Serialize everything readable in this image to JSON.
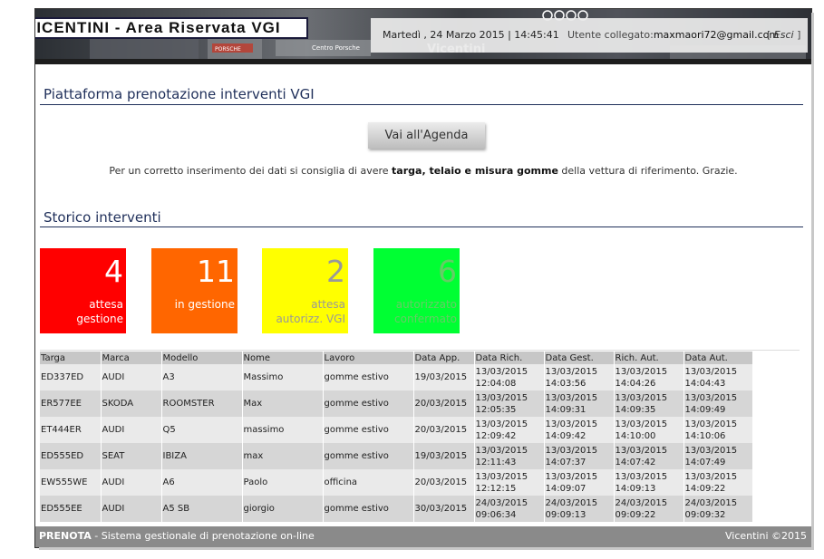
{
  "header": {
    "brand": "VICENTINI - Area Riservata VGI",
    "date": "Martedì , 24 Marzo 2015 | 14:45:41",
    "user_label": "Utente collegato:",
    "user_email": "maxmaori72@gmail.com",
    "logout_open": "[ ",
    "logout_label": "Esci",
    "logout_close": " ]",
    "background_texts": [
      "PORSCHE",
      "Centro Porsche",
      "Vicentini"
    ]
  },
  "platform": {
    "title": "Piattaforma prenotazione interventi VGI",
    "agenda_button": "Vai all'Agenda",
    "note_pre": "Per un corretto inserimento dei dati si consiglia di avere ",
    "note_bold": "targa, telaio e misura gomme",
    "note_post": " della vettura di riferimento. Grazie."
  },
  "storico": {
    "title": "Storico interventi",
    "tiles": [
      {
        "count": "4",
        "label": "attesa\ngestione",
        "bg": "#ff0000",
        "fg": "#ffffff"
      },
      {
        "count": "11",
        "label": "in gestione",
        "bg": "#ff6600",
        "fg": "#ffffff"
      },
      {
        "count": "2",
        "label": "attesa\nautorizz. VGI",
        "bg": "#ffff00",
        "fg": "#999999"
      },
      {
        "count": "6",
        "label": "autorizzato\nconfermato",
        "bg": "#00ff33",
        "fg": "#66cc66"
      }
    ]
  },
  "table": {
    "columns": [
      "Targa",
      "Marca",
      "Modello",
      "Nome",
      "Lavoro",
      "Data App.",
      "Data Rich.",
      "Data Gest.",
      "Rich. Aut.",
      "Data Aut."
    ],
    "rows": [
      [
        "ED337ED",
        "AUDI",
        "A3",
        "Massimo",
        "gomme estivo",
        "19/03/2015",
        "13/03/2015 12:04:08",
        "13/03/2015 14:03:56",
        "13/03/2015 14:04:26",
        "13/03/2015 14:04:43"
      ],
      [
        "ER577EE",
        "SKODA",
        "ROOMSTER",
        "Max",
        "gomme estivo",
        "20/03/2015",
        "13/03/2015 12:05:35",
        "13/03/2015 14:09:31",
        "13/03/2015 14:09:35",
        "13/03/2015 14:09:49"
      ],
      [
        "ET444ER",
        "AUDI",
        "Q5",
        "massimo",
        "gomme estivo",
        "20/03/2015",
        "13/03/2015 12:09:42",
        "13/03/2015 14:09:42",
        "13/03/2015 14:10:00",
        "13/03/2015 14:10:06"
      ],
      [
        "ED555ED",
        "SEAT",
        "IBIZA",
        "max",
        "gomme estivo",
        "19/03/2015",
        "13/03/2015 12:11:43",
        "13/03/2015 14:07:37",
        "13/03/2015 14:07:42",
        "13/03/2015 14:07:49"
      ],
      [
        "EW555WE",
        "AUDI",
        "A6",
        "Paolo",
        "officina",
        "20/03/2015",
        "13/03/2015 12:12:15",
        "13/03/2015 14:09:07",
        "13/03/2015 14:09:13",
        "13/03/2015 14:09:22"
      ],
      [
        "ED555EE",
        "AUDI",
        "A5 SB",
        "giorgio",
        "gomme estivo",
        "30/03/2015",
        "24/03/2015 09:06:34",
        "24/03/2015 09:09:13",
        "24/03/2015 09:09:22",
        "24/03/2015 09:09:32"
      ]
    ]
  },
  "footer": {
    "app_name": "PRENOTA",
    "app_desc": " - Sistema gestionale di prenotazione on-line",
    "copyright": "Vicentini ©2015"
  }
}
